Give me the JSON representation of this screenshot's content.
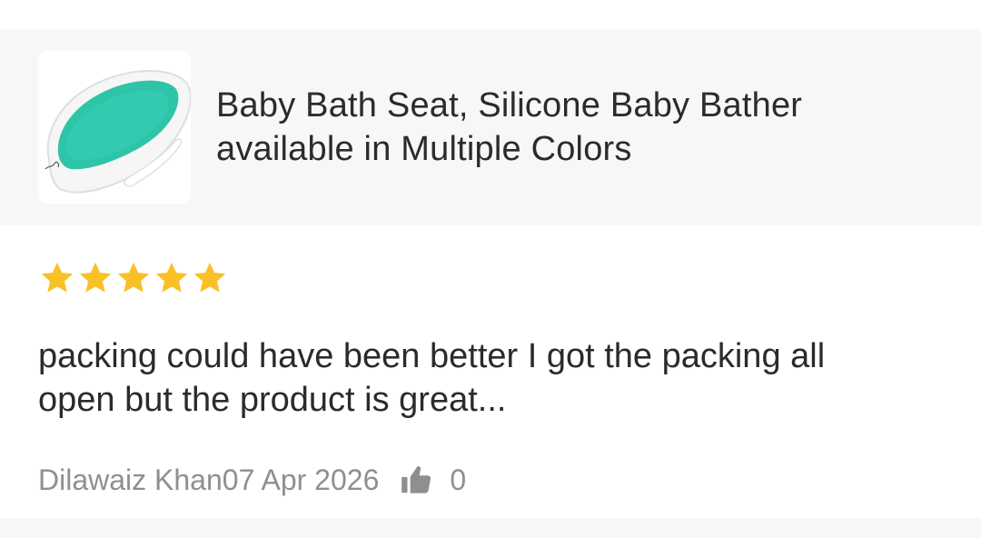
{
  "product": {
    "title_line1": "Baby Bath Seat, Silicone Baby Bather",
    "title_line2": "available in Multiple Colors",
    "image_icon": "baby-bath-seat-image"
  },
  "review": {
    "rating": 5,
    "rating_max": 5,
    "star_color": "#f9c127",
    "text_line1": "packing could have been better I got the packing all",
    "text_line2": "open but the product is great...",
    "author": "Dilawaiz Khan",
    "date": "07 Apr 2026",
    "like_count": "0",
    "like_icon": "thumbs-up-icon"
  }
}
